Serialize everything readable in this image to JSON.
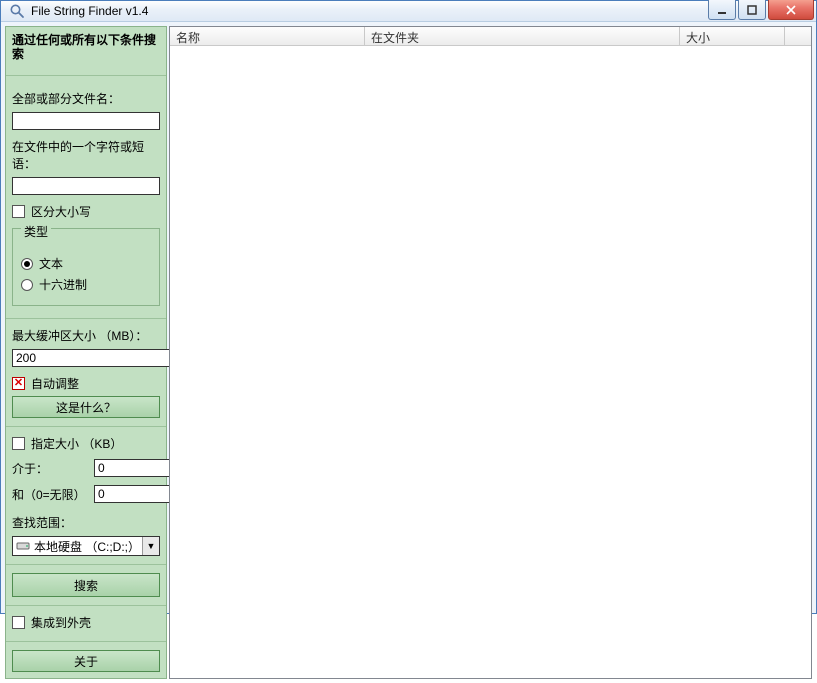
{
  "window": {
    "title": "File String Finder v1.4"
  },
  "sidebar": {
    "heading": "通过任何或所有以下条件搜索",
    "filename_label": "全部或部分文件名：",
    "filename_value": "",
    "content_label": "在文件中的一个字符或短语：",
    "content_value": "",
    "case_label": "区分大小写",
    "type_group": {
      "legend": "类型",
      "text": "文本",
      "hex": "十六进制"
    },
    "buffer_label": "最大缓冲区大小 （MB）：",
    "buffer_value": "200",
    "auto_adjust": "自动调整",
    "what_is_this": "这是什么？",
    "size_section": {
      "enable": "指定大小 （KB）",
      "between": "介于：",
      "between_val": "0",
      "and": "和（0=无限）",
      "and_val": "0"
    },
    "scope_label": "查找范围：",
    "scope_value": "本地硬盘 （C:;D:;）",
    "search_btn": "搜索",
    "shell_integrate": "集成到外壳",
    "about_btn": "关于"
  },
  "columns": {
    "name": "名称",
    "folder": "在文件夹",
    "size": "大小"
  }
}
